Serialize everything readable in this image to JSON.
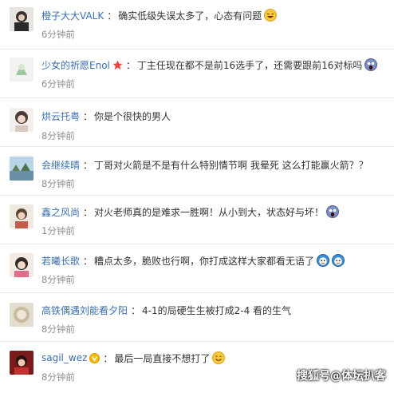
{
  "comments": [
    {
      "name": "橙子大大VALK",
      "text": "确实低级失误太多了，心态有问题",
      "time": "6分钟前",
      "emoji": "laughing-emoji-icon"
    },
    {
      "name": "少女的祈愿Enol",
      "text": "丁主任现在都不是前16选手了，还需要跟前16对标吗",
      "time": "6分钟前",
      "emoji": "screaming-emoji-icon",
      "badge": "star-badge-icon"
    },
    {
      "name": "烘云托粤",
      "text": "你是个很快的男人",
      "time": "8分钟前"
    },
    {
      "name": "会继续晴",
      "text": "丁哥对火箭是不是有什么特别情节啊 我晕死 这么打能赢火箭？？",
      "time": "8分钟前"
    },
    {
      "name": "鑫之风尚",
      "text": "对火老师真的是难求一胜啊！从小到大，状态好与坏！",
      "time": "1分钟前",
      "emoji": "screaming-emoji-icon"
    },
    {
      "name": "若曦长歌",
      "text": "糟点太多，脆败也行啊，你打成这样大家都看无语了",
      "time": "8分钟前",
      "emoji": "sweat-emoji-icon",
      "emoji2": "sweat-emoji-icon"
    },
    {
      "name": "高铁偶遇刘能看夕阳",
      "text": "4-1的局硬生生被打成2-4 看的生气",
      "time": "8分钟前"
    },
    {
      "name": "sagil_wez",
      "text": "最后一局直接不想打了",
      "time": "8分钟前",
      "emoji": "smile-emoji-icon",
      "badge": "vip-badge-icon"
    }
  ],
  "watermark": "搜狐号@体坛扒客",
  "colors": {
    "username": "#3b6fb0",
    "time": "#8f8f8f",
    "divider": "#ececec"
  }
}
